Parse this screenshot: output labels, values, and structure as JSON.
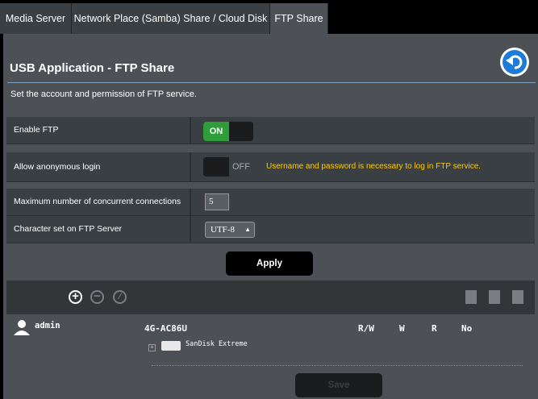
{
  "tabs": [
    "Media Server",
    "Network Place (Samba) Share / Cloud Disk",
    "FTP Share"
  ],
  "title": "USB Application - FTP Share",
  "description": "Set the account and permission of FTP service.",
  "settings": {
    "enable_ftp": {
      "label": "Enable FTP",
      "state": "ON"
    },
    "anonymous": {
      "label": "Allow anonymous login",
      "state": "OFF",
      "note": "Username and password is necessary to log in FTP service."
    },
    "max_conn": {
      "label": "Maximum number of concurrent connections",
      "value": "5"
    },
    "charset": {
      "label": "Character set on FTP Server",
      "value": "UTF-8"
    }
  },
  "apply_label": "Apply",
  "accounts": {
    "user": "admin",
    "device": "4G-AC86U",
    "columns": [
      "R/W",
      "W",
      "R",
      "No"
    ],
    "disk": "SanDisk Extreme"
  },
  "save_label": "Save",
  "colors": {
    "accent": "#1e7bd8",
    "on": "#2f9d3a",
    "warning": "#ffcc00"
  }
}
